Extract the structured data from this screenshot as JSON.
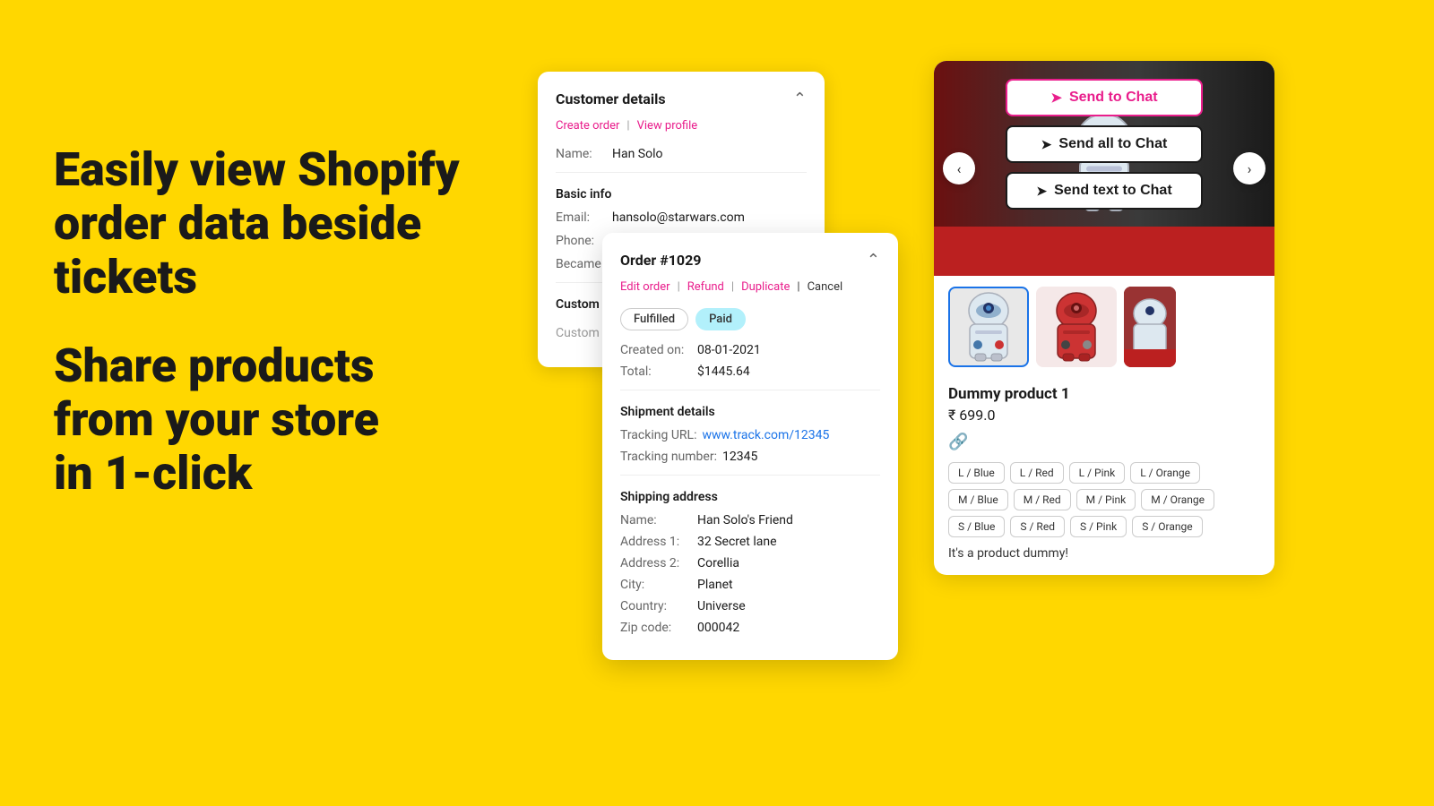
{
  "background_color": "#FFD700",
  "hero": {
    "line1": "Easily view Shopify",
    "line2": "order data beside",
    "line3": "tickets",
    "line4": "Share products",
    "line5": "from your store",
    "line6": "in 1-click"
  },
  "customer_card": {
    "title": "Customer details",
    "action_create": "Create order",
    "action_view": "View profile",
    "name_label": "Name:",
    "name_value": "Han Solo",
    "basic_info_title": "Basic info",
    "email_label": "Email:",
    "email_value": "hansolo@starwars.com",
    "phone_label": "Phone:",
    "became_label": "Became"
  },
  "order_card": {
    "title": "Order #1029",
    "action_edit": "Edit order",
    "action_refund": "Refund",
    "action_duplicate": "Duplicate",
    "action_cancel": "Cancel",
    "badge_fulfilled": "Fulfilled",
    "badge_paid": "Paid",
    "created_label": "Created on:",
    "created_value": "08-01-2021",
    "total_label": "Total:",
    "total_value": "$1445.64",
    "shipment_title": "Shipment details",
    "tracking_url_label": "Tracking URL:",
    "tracking_url_value": "www.track.com/12345",
    "tracking_number_label": "Tracking number:",
    "tracking_number_value": "12345",
    "shipping_title": "Shipping address",
    "ship_name_label": "Name:",
    "ship_name_value": "Han Solo's Friend",
    "address1_label": "Address 1:",
    "address1_value": "32 Secret lane",
    "address2_label": "Address 2:",
    "address2_value": "Corellia",
    "city_label": "City:",
    "city_value": "Planet",
    "country_label": "Country:",
    "country_value": "Universe",
    "zip_label": "Zip code:",
    "zip_value": "000042"
  },
  "product_card": {
    "btn_send_to_chat": "Send to Chat",
    "btn_send_all_to_chat": "Send all to Chat",
    "btn_send_text_to_chat": "Send text to Chat",
    "product_name": "Dummy product 1",
    "product_price": "₹ 699.0",
    "product_description": "It's a product dummy!",
    "variants": [
      "L / Blue",
      "L / Red",
      "L / Pink",
      "L / Orange",
      "M / Blue",
      "M / Red",
      "M / Pink",
      "M / Orange",
      "S / Blue",
      "S / Red",
      "S / Pink",
      "S / Orange"
    ],
    "nav_left": "‹",
    "nav_right": "›"
  }
}
